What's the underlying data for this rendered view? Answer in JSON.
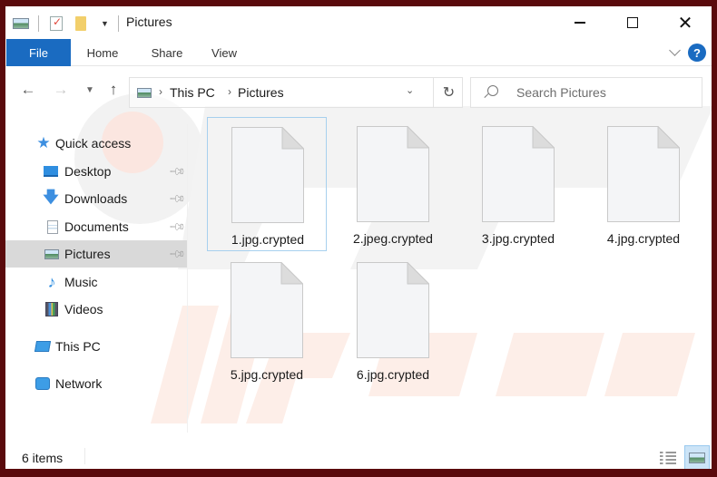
{
  "window": {
    "title": "Pictures",
    "minimize_label": "Minimize",
    "maximize_label": "Maximize",
    "close_label": "Close"
  },
  "quick_access_toolbar": {
    "icons": [
      "pictures-folder-icon",
      "properties-icon",
      "new-folder-icon",
      "customize-dropdown-icon"
    ]
  },
  "ribbon": {
    "tabs": [
      {
        "label": "File",
        "active": true
      },
      {
        "label": "Home"
      },
      {
        "label": "Share"
      },
      {
        "label": "View"
      }
    ],
    "help_label": "?"
  },
  "navigation": {
    "back_icon": "←",
    "forward_icon": "→",
    "recent_icon": "⌄",
    "up_icon": "↑",
    "breadcrumb": [
      "This PC",
      "Pictures"
    ],
    "breadcrumb_separator": "›",
    "refresh_icon": "↻",
    "search_placeholder": "Search Pictures"
  },
  "nav_pane": {
    "items": [
      {
        "label": "Quick access",
        "icon": "star-icon",
        "level": 0
      },
      {
        "label": "Desktop",
        "icon": "desktop-icon",
        "level": 1,
        "pinned": true
      },
      {
        "label": "Downloads",
        "icon": "downloads-icon",
        "level": 1,
        "pinned": true
      },
      {
        "label": "Documents",
        "icon": "documents-icon",
        "level": 1,
        "pinned": true
      },
      {
        "label": "Pictures",
        "icon": "pictures-icon",
        "level": 1,
        "pinned": true,
        "selected": true
      },
      {
        "label": "Music",
        "icon": "music-icon",
        "level": 1
      },
      {
        "label": "Videos",
        "icon": "videos-icon",
        "level": 1
      },
      {
        "label": "This PC",
        "icon": "this-pc-icon",
        "level": 0
      },
      {
        "label": "Network",
        "icon": "network-icon",
        "level": 0
      }
    ]
  },
  "files": [
    {
      "name": "1.jpg.crypted",
      "focused": true
    },
    {
      "name": "2.jpeg.crypted"
    },
    {
      "name": "3.jpg.crypted"
    },
    {
      "name": "4.jpg.crypted"
    },
    {
      "name": "5.jpg.crypted"
    },
    {
      "name": "6.jpg.crypted"
    }
  ],
  "status_bar": {
    "item_count": "6 items",
    "views": [
      {
        "name": "details-view",
        "active": false
      },
      {
        "name": "large-icons-view",
        "active": true
      }
    ]
  },
  "colors": {
    "accent": "#1a6bc1",
    "frame": "#5a0a0c",
    "selected_nav": "#d9d9d9",
    "focus_border": "#a7d0ee"
  }
}
